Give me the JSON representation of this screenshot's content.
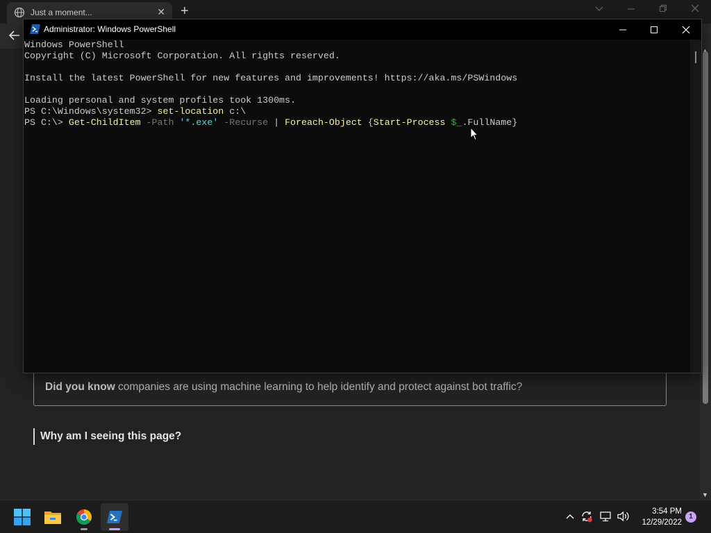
{
  "browser": {
    "tab_title": "Just a moment...",
    "tab_close": "✕",
    "new_tab": "+"
  },
  "page": {
    "did_you_know_bold": "Did you know",
    "did_you_know_rest": " companies are using machine learning to help identify and protect against bot traffic?",
    "why_heading": "Why am I seeing this page?"
  },
  "powershell": {
    "window_title": "Administrator: Windows PowerShell",
    "lines": {
      "l1": "Windows PowerShell",
      "l2": "Copyright (C) Microsoft Corporation. All rights reserved.",
      "l4": "Install the latest PowerShell for new features and improvements! https://aka.ms/PSWindows",
      "l6": "Loading personal and system profiles took 1300ms.",
      "l7_prompt": "PS C:\\Windows\\system32> ",
      "l7_cmd": "set-location",
      "l7_arg": " c:\\",
      "l8_prompt": "PS C:\\> ",
      "l8_cmd1": "Get-ChildItem",
      "l8_param1": " -Path ",
      "l8_str": "'*.exe'",
      "l8_param2": " -Recurse",
      "l8_pipe": " | ",
      "l8_cmd2": "Foreach-Object",
      "l8_brace_open": " {",
      "l8_cmd3": "Start-Process",
      "l8_sp": " ",
      "l8_var": "$_",
      "l8_prop": ".FullName}"
    }
  },
  "taskbar": {
    "time": "3:54 PM",
    "date": "12/29/2022",
    "notification_count": "1",
    "apps": [
      "start-icon",
      "file-explorer-icon",
      "chrome-icon",
      "powershell-icon"
    ]
  },
  "colors": {
    "terminal_bg": "#0c0c0c",
    "terminal_text": "#cccccc",
    "command_yellow": "#f9f1a5",
    "param_gray": "#767676",
    "string_cyan": "#61d6d6",
    "variable_green": "#16c60c",
    "windows_blue": "#0f6cbd"
  }
}
